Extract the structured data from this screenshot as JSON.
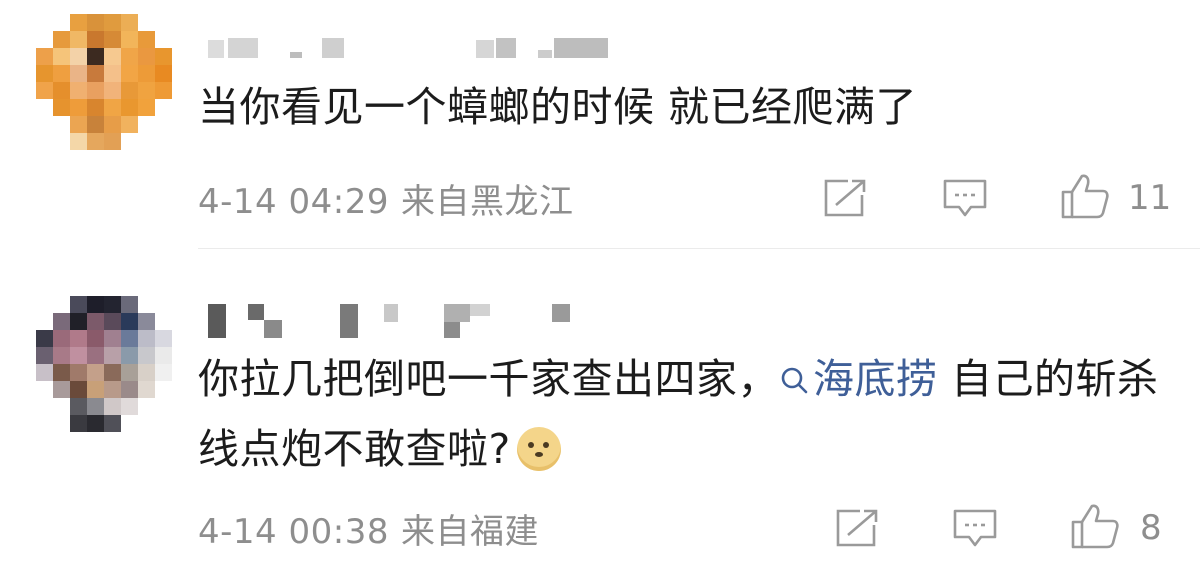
{
  "comments": [
    {
      "text": "当你看见一个蟑螂的时候 就已经爬满了",
      "date": "4-14 04:29",
      "location": "来自黑龙江",
      "likes": "11"
    },
    {
      "text_before": "你拉几把倒吧一千家查出四家，",
      "topic": "海底捞",
      "text_after": " 自己的斩杀线点炮不敢查啦?",
      "date": "4-14 00:38",
      "location": "来自福建",
      "likes": "8",
      "emoji": "doge-emoji"
    }
  ],
  "icons": {
    "share": "share-icon",
    "reply": "comment-icon",
    "like": "thumbs-up-icon",
    "topic": "search-icon"
  },
  "colors": {
    "link": "#3f5f98",
    "meta": "#8e8e8e",
    "text": "#1c1c1c"
  }
}
